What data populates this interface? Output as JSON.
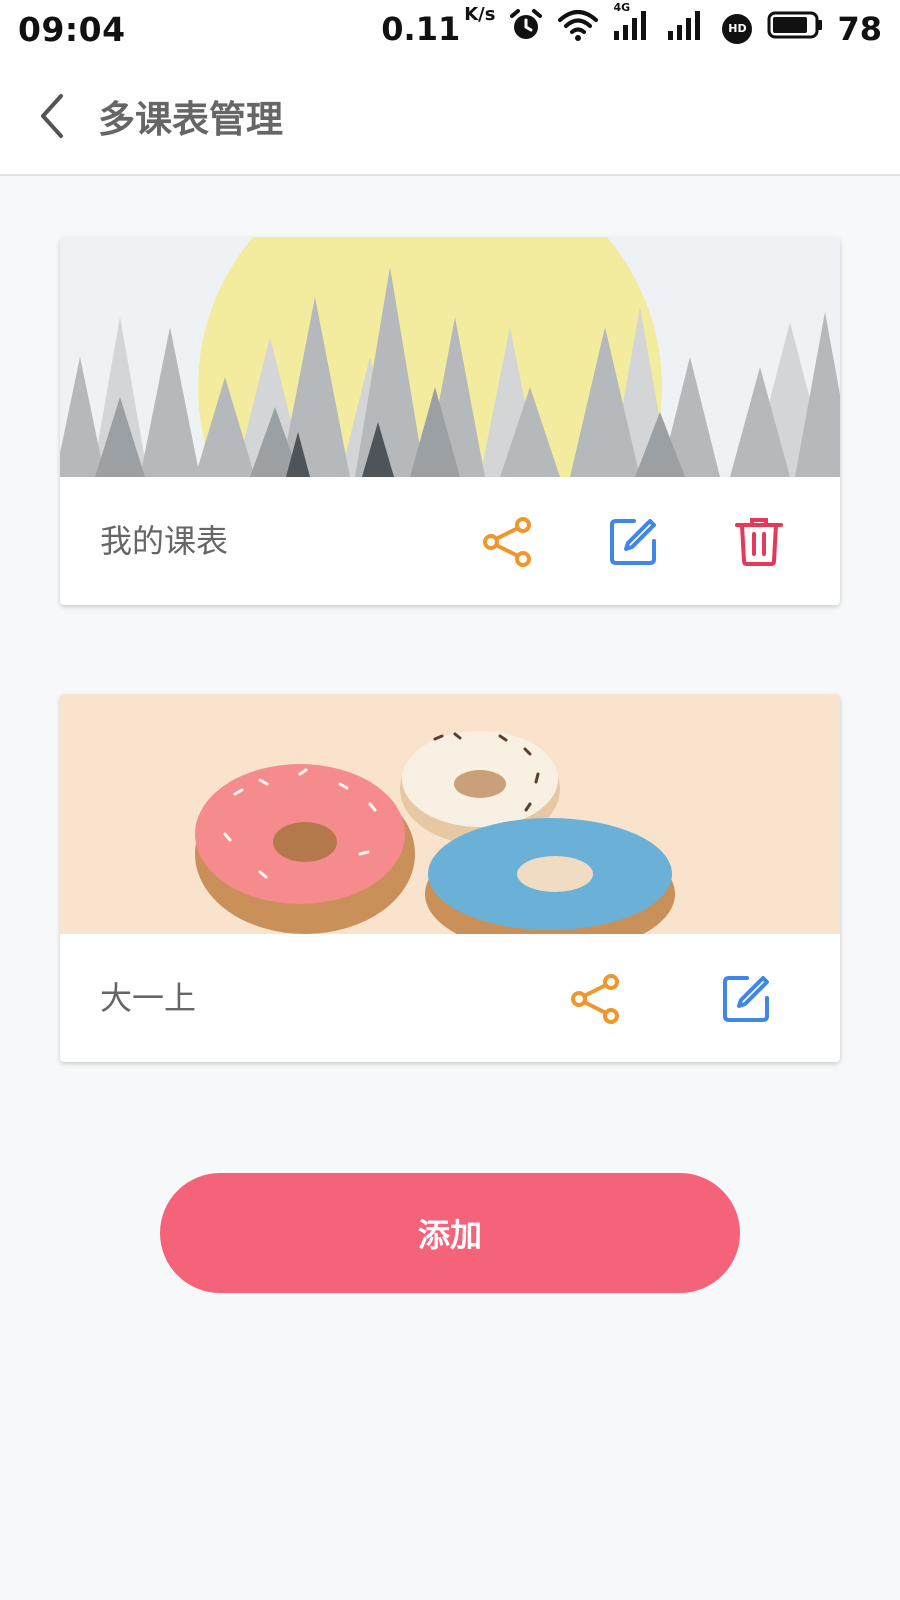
{
  "status_bar": {
    "time": "09:04",
    "network_speed": "0.11",
    "speed_unit": "K/s",
    "battery": "78",
    "network_type": "4G",
    "hd": "HD"
  },
  "app_bar": {
    "title": "多课表管理"
  },
  "schedules": [
    {
      "name": "我的课表",
      "image": "forest-sun-illustration",
      "actions": [
        "share",
        "edit",
        "delete"
      ]
    },
    {
      "name": "大一上",
      "image": "donuts-illustration",
      "actions": [
        "share",
        "edit"
      ]
    }
  ],
  "add_button": {
    "label": "添加"
  },
  "colors": {
    "share": "#f0962a",
    "edit": "#3f86e8",
    "delete": "#e5385a",
    "add_button": "#f5637a"
  }
}
